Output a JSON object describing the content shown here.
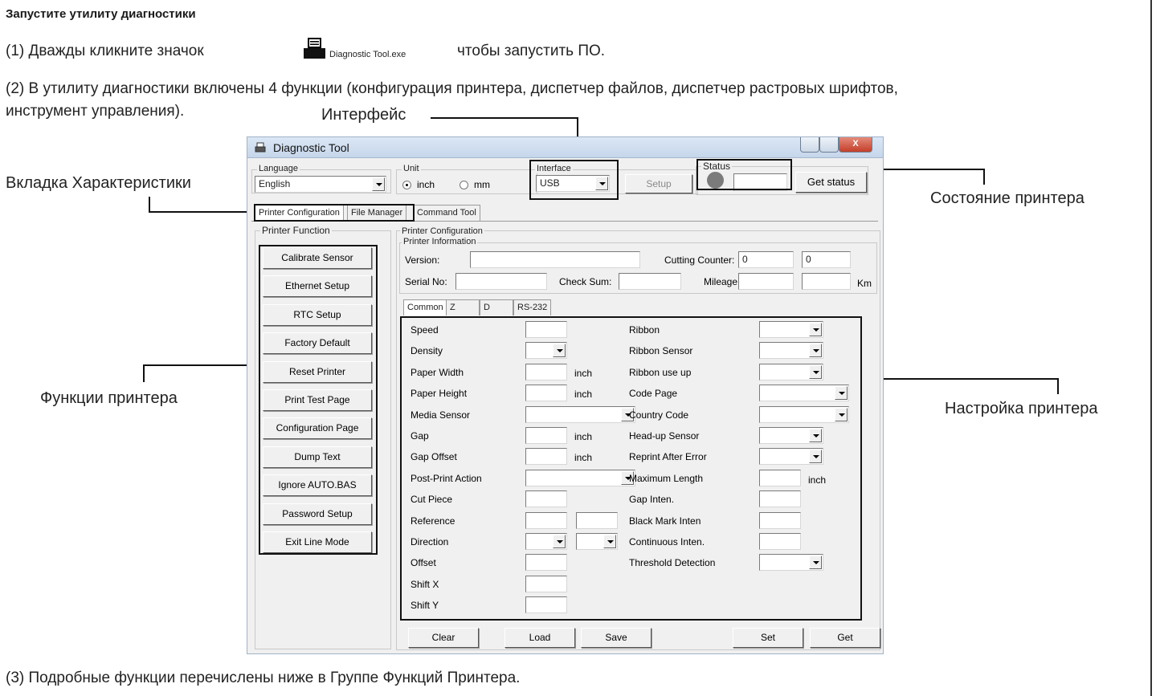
{
  "doc": {
    "heading": "Запустите утилиту диагностики",
    "step1_before": "(1) Дважды кликните значок",
    "step1_icon_label": "Diagnostic Tool.exe",
    "step1_after": "чтобы запустить ПО.",
    "step2_line1": "(2) В утилиту диагностики включены 4 функции (конфигурация принтера, диспетчер файлов, диспетчер растровых шрифтов,",
    "step2_line2": "инструмент управления).",
    "step3": "(3) Подробные функции перечислены ниже в Группе Функций Принтера."
  },
  "annotations": {
    "interface": "Интерфейс",
    "tabs": "Вкладка Характеристики",
    "status": "Состояние принтера",
    "functions": "Функции принтера",
    "settings": "Настройка принтера"
  },
  "window": {
    "title": "Diagnostic Tool",
    "close_glyph": "X",
    "language": {
      "label": "Language",
      "value": "English"
    },
    "unit": {
      "label": "Unit",
      "options": [
        "inch",
        "mm"
      ],
      "selected": "inch"
    },
    "interface": {
      "label": "Interface",
      "value": "USB",
      "setup": "Setup"
    },
    "status": {
      "label": "Status",
      "button": "Get status"
    },
    "tabs": [
      "Printer Configuration",
      "File Manager",
      "Command Tool"
    ],
    "printer_function": {
      "label": "Printer Function",
      "buttons": [
        "Calibrate Sensor",
        "Ethernet Setup",
        "RTC Setup",
        "Factory Default",
        "Reset Printer",
        "Print Test Page",
        "Configuration Page",
        "Dump Text",
        "Ignore AUTO.BAS",
        "Password Setup",
        "Exit Line Mode"
      ]
    },
    "config": {
      "label": "Printer Configuration",
      "info_label": "Printer Information",
      "version": "Version:",
      "cutting_counter": "Cutting Counter:",
      "cutting_value1": "0",
      "cutting_value2": "0",
      "serial": "Serial No:",
      "checksum": "Check Sum:",
      "mileage": "Mileage:",
      "km": "Km",
      "subtabs": [
        "Common",
        "Z",
        "D",
        "RS-232"
      ],
      "left_rows": [
        "Speed",
        "Density",
        "Paper Width",
        "Paper Height",
        "Media Sensor",
        "Gap",
        "Gap Offset",
        "Post-Print Action",
        "Cut Piece",
        "Reference",
        "Direction",
        "Offset",
        "Shift X",
        "Shift Y"
      ],
      "right_rows": [
        "Ribbon",
        "Ribbon Sensor",
        "Ribbon use up",
        "Code Page",
        "Country Code",
        "Head-up Sensor",
        "Reprint After Error",
        "Maximum Length",
        "Gap Inten.",
        "Black Mark Inten",
        "Continuous Inten.",
        "Threshold Detection"
      ],
      "unit_inch": "inch"
    },
    "bottom_buttons": [
      "Clear",
      "Load",
      "Save",
      "Set",
      "Get"
    ]
  }
}
